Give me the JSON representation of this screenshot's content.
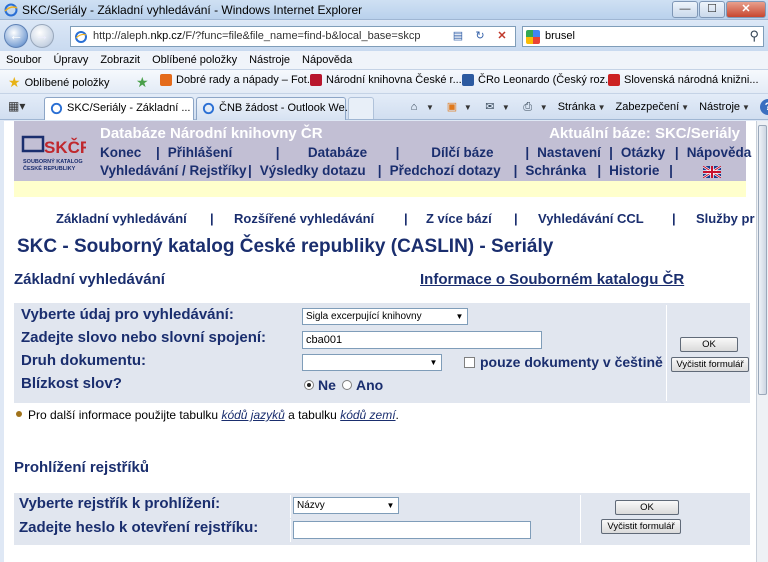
{
  "window": {
    "title": "SKC/Seriály - Základní vyhledávání - Windows Internet Explorer",
    "minimize": "—",
    "maximize": "☐",
    "close": "✕"
  },
  "address": {
    "url_prefix": "http://aleph.",
    "url_domain": "nkp.cz",
    "url_rest": "/F/?func=file&file_name=find-b&local_base=skcp",
    "search_value": "brusel"
  },
  "menu": [
    "Soubor",
    "Úpravy",
    "Zobrazit",
    "Oblíbené položky",
    "Nástroje",
    "Nápověda"
  ],
  "favorites": {
    "main_label": "Oblíbené položky",
    "items": [
      "Dobré rady a nápady – Fot...",
      "Národní knihovna České r...",
      "ČRo Leonardo (Český roz...",
      "Slovenská národná knižni..."
    ]
  },
  "tabs": {
    "active": "SKC/Seriály - Základní ...",
    "inactive": "ČNB žádost - Outlook We..."
  },
  "commandbar": {
    "page": "Stránka",
    "safety": "Zabezpečení",
    "tools": "Nástroje"
  },
  "site": {
    "db_title": "Databáze Národní knihovny ČR",
    "current_base": "Aktuální báze:  SKC/Seriály",
    "row1": [
      "Konec",
      "Přihlášení",
      "Databáze",
      "Dílčí báze",
      "Nastavení",
      "Otázky",
      "Nápověda"
    ],
    "row2": [
      "Vyhledávání / Rejstříky",
      "Výsledky dotazu",
      "Předchozí dotazy",
      "Schránka",
      "Historie"
    ],
    "logo_text": "SKČR",
    "logo_sub1": "SOUBORNÝ KATALOG",
    "logo_sub2": "ČESKÉ REPUBLIKY"
  },
  "search_nav": [
    "Základní vyhledávání",
    "Rozšířené vyhledávání",
    "Z více bází",
    "Vyhledávání CCL",
    "Služby pr"
  ],
  "page": {
    "title": "SKC -  Souborný katalog České republiky (CASLIN) - Seriály",
    "subtitle": "Základní vyhledávání",
    "info_link": "Informace o Souborném katalogu ČR"
  },
  "form": {
    "field_label": "Vyberte údaj pro vyhledávání:",
    "field_value": "Sigla excerpující knihovny",
    "word_label": "Zadejte slovo nebo slovní spojení:",
    "word_value": "cba001",
    "doctype_label": "Druh dokumentu:",
    "doctype_value": "",
    "czech_only": "pouze dokumenty v češtině",
    "proximity_label": "Blízkost slov?",
    "proximity_no": "Ne",
    "proximity_yes": "Ano",
    "ok": "OK",
    "clear": "Vyčistit formulář"
  },
  "help": {
    "pre": "Pro další informace použijte tabulku ",
    "link1": "kódů jazyků",
    "mid": " a tabulku ",
    "link2": "kódů zemí",
    "post": "."
  },
  "browse": {
    "heading": "Prohlížení rejstříků",
    "index_label": "Vyberte rejstřík k prohlížení:",
    "index_value": "Názvy",
    "heading_label": "Zadejte heslo k otevření rejstříku:",
    "heading_value": "",
    "ok": "OK",
    "clear": "Vyčistit formulář"
  }
}
